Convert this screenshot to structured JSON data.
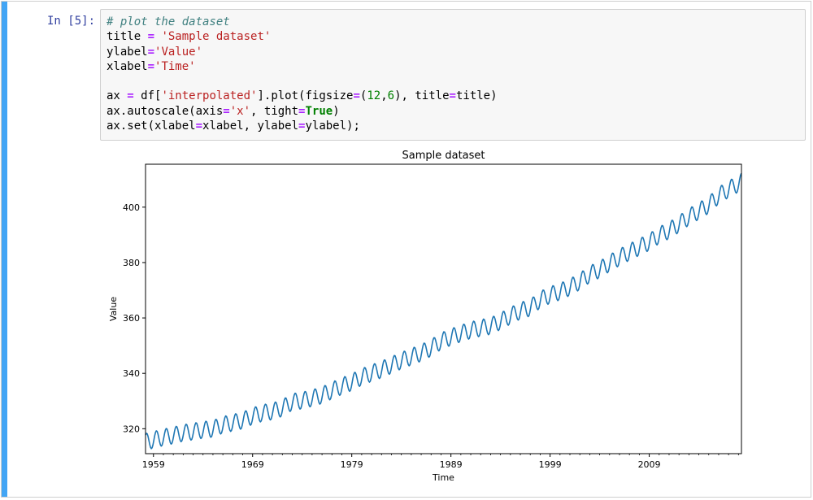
{
  "cell": {
    "prompt": "In [5]:",
    "code_lines": [
      [
        {
          "t": "# plot the dataset",
          "c": "comment"
        }
      ],
      [
        {
          "t": "title ",
          "c": ""
        },
        {
          "t": "=",
          "c": "op"
        },
        {
          "t": " ",
          "c": ""
        },
        {
          "t": "'Sample dataset'",
          "c": "str"
        }
      ],
      [
        {
          "t": "ylabel",
          "c": ""
        },
        {
          "t": "=",
          "c": "op"
        },
        {
          "t": "'Value'",
          "c": "str"
        }
      ],
      [
        {
          "t": "xlabel",
          "c": ""
        },
        {
          "t": "=",
          "c": "op"
        },
        {
          "t": "'Time'",
          "c": "str"
        }
      ],
      [
        {
          "t": "",
          "c": ""
        }
      ],
      [
        {
          "t": "ax ",
          "c": ""
        },
        {
          "t": "=",
          "c": "op"
        },
        {
          "t": " df[",
          "c": ""
        },
        {
          "t": "'interpolated'",
          "c": "str"
        },
        {
          "t": "].plot(figsize",
          "c": ""
        },
        {
          "t": "=",
          "c": "op"
        },
        {
          "t": "(",
          "c": ""
        },
        {
          "t": "12",
          "c": "num"
        },
        {
          "t": ",",
          "c": ""
        },
        {
          "t": "6",
          "c": "num"
        },
        {
          "t": "), title",
          "c": ""
        },
        {
          "t": "=",
          "c": "op"
        },
        {
          "t": "title)",
          "c": ""
        }
      ],
      [
        {
          "t": "ax.autoscale(axis",
          "c": ""
        },
        {
          "t": "=",
          "c": "op"
        },
        {
          "t": "'x'",
          "c": "str"
        },
        {
          "t": ", tight",
          "c": ""
        },
        {
          "t": "=",
          "c": "op"
        },
        {
          "t": "True",
          "c": "kw"
        },
        {
          "t": ")",
          "c": ""
        }
      ],
      [
        {
          "t": "ax.set(xlabel",
          "c": ""
        },
        {
          "t": "=",
          "c": "op"
        },
        {
          "t": "xlabel, ylabel",
          "c": ""
        },
        {
          "t": "=",
          "c": "op"
        },
        {
          "t": "ylabel);",
          "c": ""
        }
      ]
    ]
  },
  "chart_data": {
    "type": "line",
    "title": "Sample dataset",
    "xlabel": "Time",
    "ylabel": "Value",
    "xlim": [
      1958.2,
      2018.3
    ],
    "ylim": [
      311.0,
      415.5
    ],
    "xticks": [
      1959,
      1969,
      1979,
      1989,
      1999,
      2009
    ],
    "yticks": [
      320,
      340,
      360,
      380,
      400
    ],
    "grid": false,
    "line_color": "#1f77b4",
    "seasonal_amplitude_ppm": 3.0,
    "series": [
      {
        "x": [
          1958.2,
          1959,
          1960,
          1961,
          1962,
          1963,
          1964,
          1965,
          1966,
          1967,
          1968,
          1969,
          1970,
          1971,
          1972,
          1973,
          1974,
          1975,
          1976,
          1977,
          1978,
          1979,
          1980,
          1981,
          1982,
          1983,
          1984,
          1985,
          1986,
          1987,
          1988,
          1989,
          1990,
          1991,
          1992,
          1993,
          1994,
          1995,
          1996,
          1997,
          1998,
          1999,
          2000,
          2001,
          2002,
          2003,
          2004,
          2005,
          2006,
          2007,
          2008,
          2009,
          2010,
          2011,
          2012,
          2013,
          2014,
          2015,
          2016,
          2017,
          2018,
          2018.3
        ],
        "y": [
          315.3,
          316.0,
          316.9,
          317.6,
          318.5,
          319.0,
          319.6,
          320.0,
          321.4,
          322.2,
          323.0,
          324.6,
          325.7,
          326.3,
          327.5,
          329.7,
          330.2,
          331.1,
          332.1,
          333.8,
          335.4,
          336.8,
          338.7,
          340.1,
          341.4,
          343.0,
          344.6,
          346.0,
          347.4,
          349.2,
          351.6,
          353.1,
          354.4,
          355.6,
          356.4,
          357.1,
          358.8,
          360.8,
          362.6,
          363.7,
          366.6,
          368.3,
          369.5,
          371.1,
          373.2,
          375.8,
          377.5,
          379.8,
          381.9,
          383.8,
          385.6,
          387.4,
          389.9,
          391.6,
          393.9,
          396.5,
          398.6,
          400.8,
          404.2,
          406.5,
          408.5,
          409.3
        ]
      }
    ]
  }
}
